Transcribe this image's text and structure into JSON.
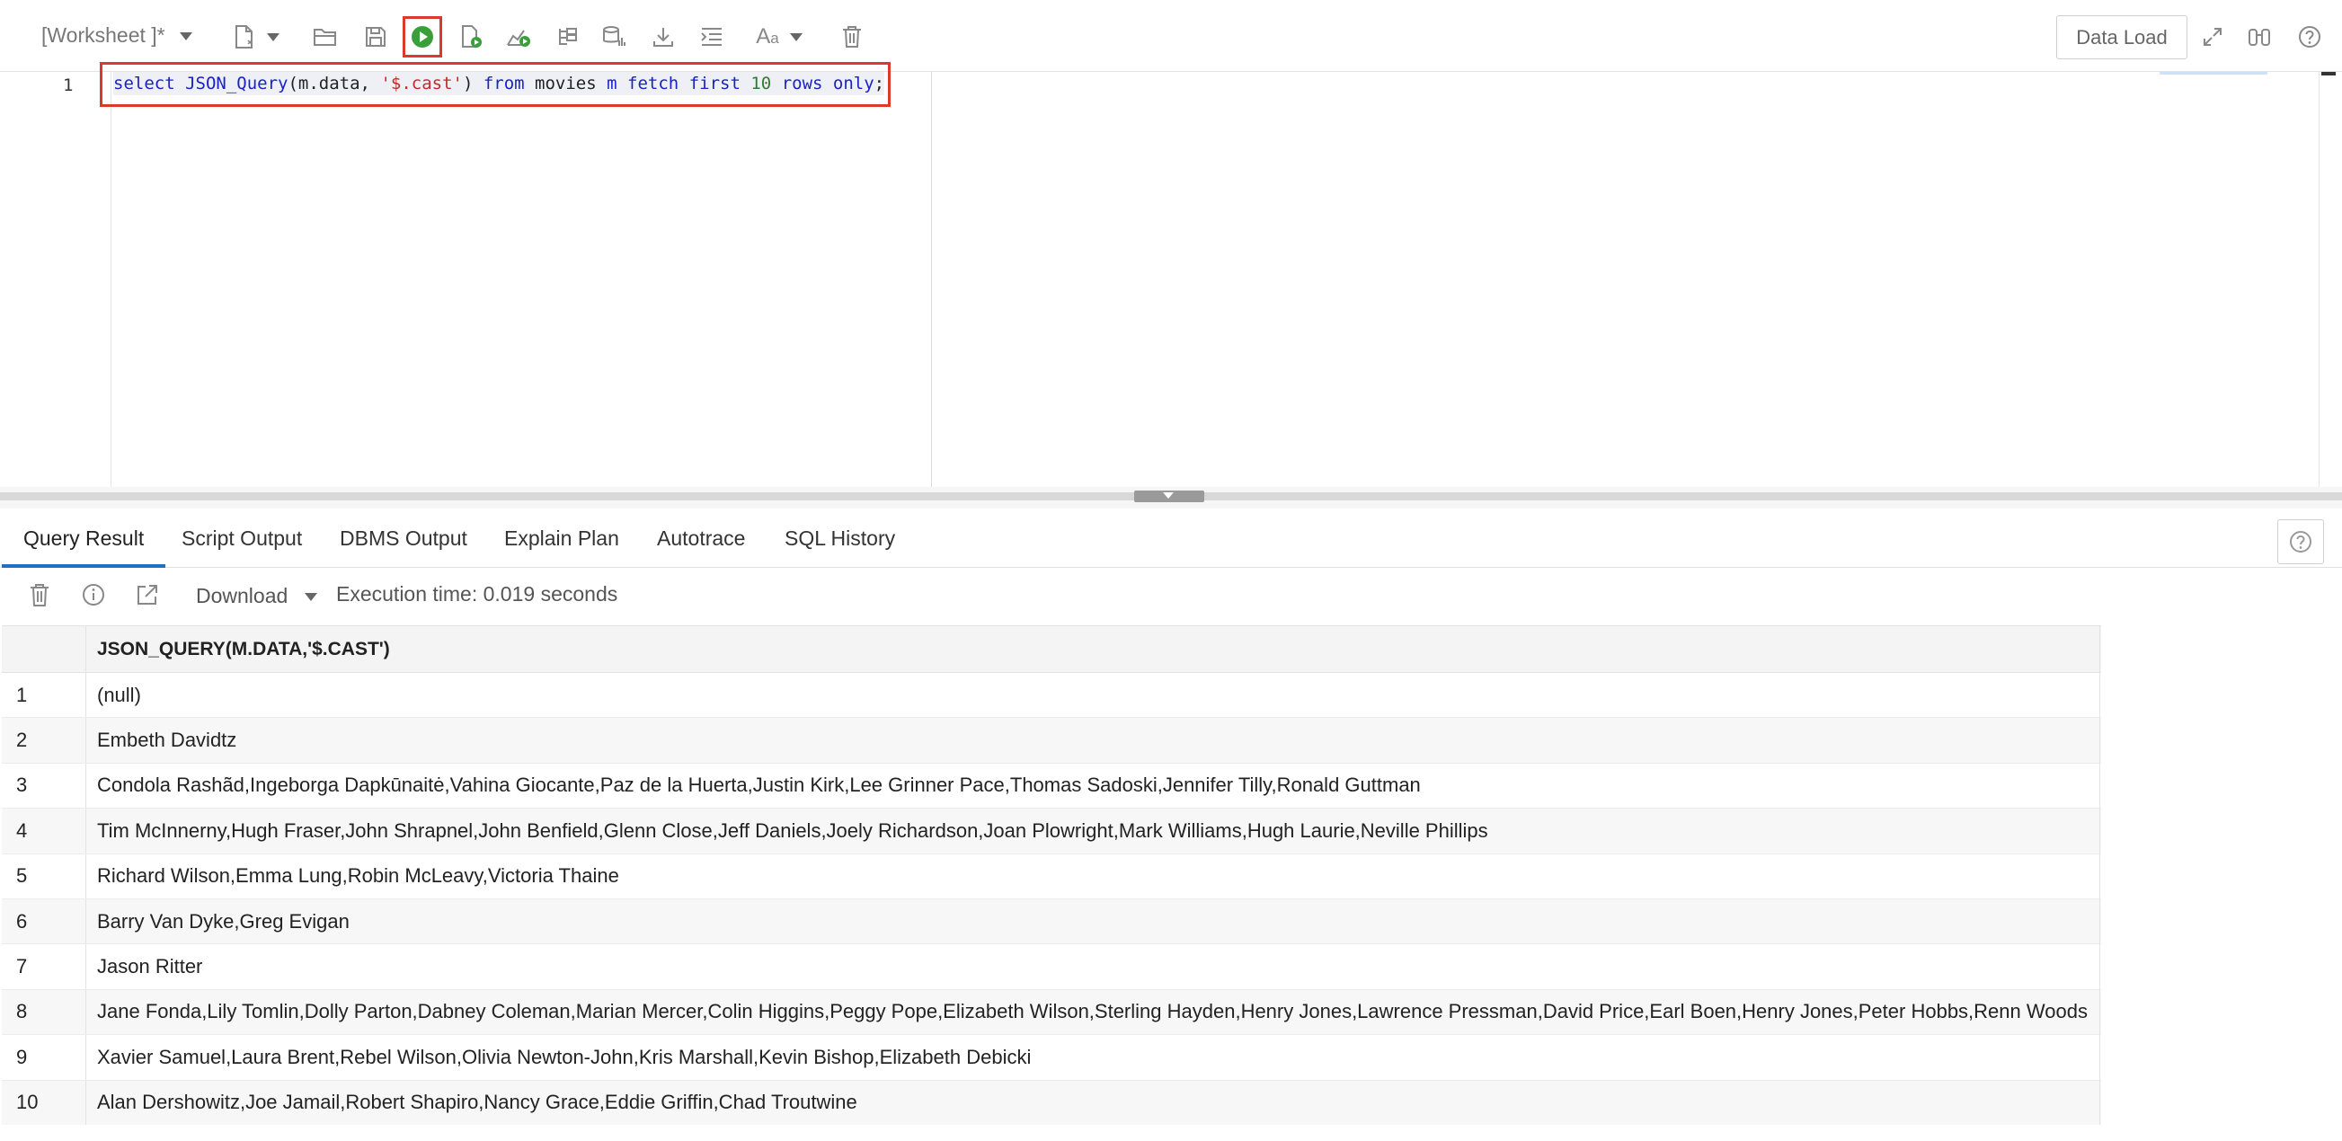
{
  "toolbar": {
    "worksheet_title": "[Worksheet ]*",
    "data_load_label": "Data Load",
    "icons": [
      "new-file-icon",
      "open-folder-icon",
      "save-icon",
      "run-statement-icon",
      "run-script-icon",
      "run-explain-icon",
      "explain-plan-icon",
      "autotrace-icon",
      "download-icon",
      "format-icon",
      "font-size-icon",
      "clear-icon",
      "expand-icon",
      "search-icon",
      "help-icon"
    ],
    "run_color": "#3a9f3a",
    "highlight_color": "#d93a2b"
  },
  "editor": {
    "line_number": "1",
    "code": {
      "t1": "select",
      "t2": "JSON_Query",
      "t3": "(m.data, ",
      "t4": "'$.cast'",
      "t5": ") ",
      "t6": "from",
      "t7": " movies ",
      "t8": "m",
      "t9": " ",
      "t10": "fetch",
      "t11": " ",
      "t12": "first",
      "t13": " ",
      "t14": "10",
      "t15": " ",
      "t16": "rows",
      "t17": " ",
      "t18": "only",
      "t19": ";"
    }
  },
  "tabs": [
    {
      "label": "Query Result",
      "active": true
    },
    {
      "label": "Script Output"
    },
    {
      "label": "DBMS Output"
    },
    {
      "label": "Explain Plan"
    },
    {
      "label": "Autotrace"
    },
    {
      "label": "SQL History"
    }
  ],
  "result_toolbar": {
    "download_label": "Download",
    "execution_time": "Execution time: 0.019 seconds"
  },
  "grid": {
    "column_header": "JSON_QUERY(M.DATA,'$.CAST')",
    "rows": [
      {
        "idx": "1",
        "value": "(null)"
      },
      {
        "idx": "2",
        "value": "Embeth Davidtz"
      },
      {
        "idx": "3",
        "value": "Condola Rashãd,Ingeborga Dapkūnaitė,Vahina Giocante,Paz de la Huerta,Justin Kirk,Lee Grinner Pace,Thomas Sadoski,Jennifer Tilly,Ronald Guttman"
      },
      {
        "idx": "4",
        "value": "Tim McInnerny,Hugh Fraser,John Shrapnel,John Benfield,Glenn Close,Jeff Daniels,Joely Richardson,Joan Plowright,Mark Williams,Hugh Laurie,Neville Phillips"
      },
      {
        "idx": "5",
        "value": "Richard Wilson,Emma Lung,Robin McLeavy,Victoria Thaine"
      },
      {
        "idx": "6",
        "value": "Barry Van Dyke,Greg Evigan"
      },
      {
        "idx": "7",
        "value": "Jason Ritter"
      },
      {
        "idx": "8",
        "value": "Jane Fonda,Lily Tomlin,Dolly Parton,Dabney Coleman,Marian Mercer,Colin Higgins,Peggy Pope,Elizabeth Wilson,Sterling Hayden,Henry Jones,Lawrence Pressman,David Price,Earl Boen,Henry Jones,Peter Hobbs,Renn Woods"
      },
      {
        "idx": "9",
        "value": "Xavier Samuel,Laura Brent,Rebel Wilson,Olivia Newton-John,Kris Marshall,Kevin Bishop,Elizabeth Debicki"
      },
      {
        "idx": "10",
        "value": "Alan Dershowitz,Joe Jamail,Robert Shapiro,Nancy Grace,Eddie Griffin,Chad Troutwine"
      }
    ]
  }
}
